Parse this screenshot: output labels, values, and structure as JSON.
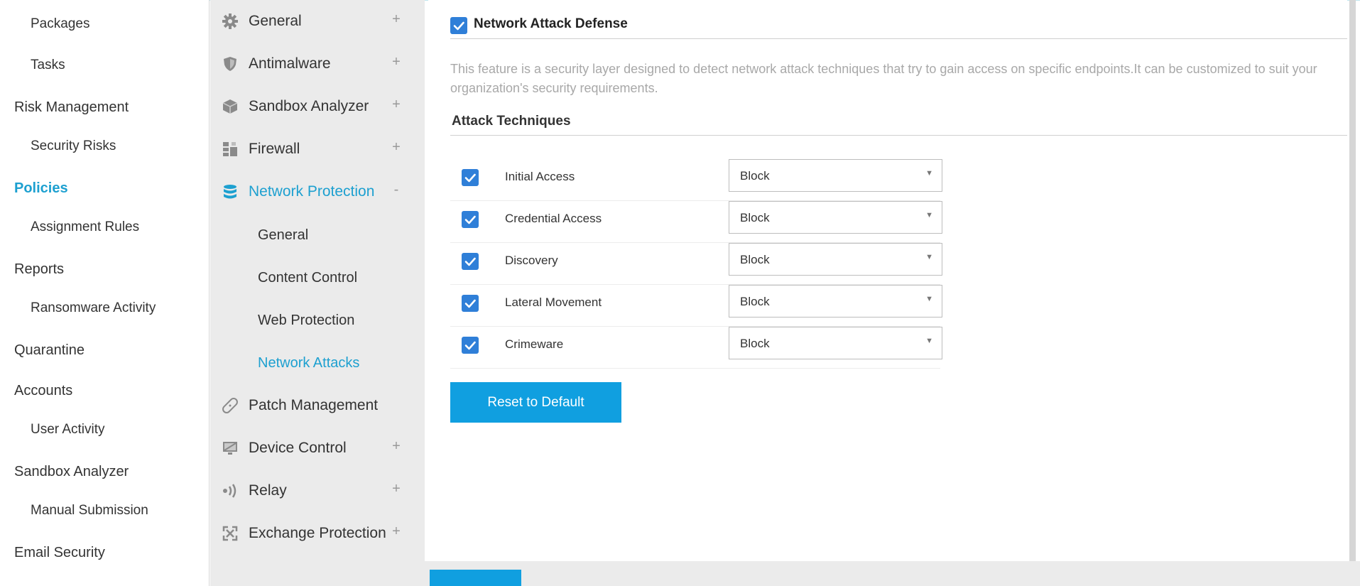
{
  "nav": {
    "items": [
      {
        "label": "Packages"
      },
      {
        "label": "Tasks"
      },
      {
        "label": "Risk Management"
      },
      {
        "label": "Security Risks"
      },
      {
        "label": "Policies"
      },
      {
        "label": "Assignment Rules"
      },
      {
        "label": "Reports"
      },
      {
        "label": "Ransomware Activity"
      },
      {
        "label": "Quarantine"
      },
      {
        "label": "Accounts"
      },
      {
        "label": "User Activity"
      },
      {
        "label": "Sandbox Analyzer"
      },
      {
        "label": "Manual Submission"
      },
      {
        "label": "Email Security"
      }
    ]
  },
  "sections": {
    "items": [
      {
        "label": "General",
        "icon": "gear-icon",
        "toggle": "+"
      },
      {
        "label": "Antimalware",
        "icon": "shield-icon",
        "toggle": "+"
      },
      {
        "label": "Sandbox Analyzer",
        "icon": "cube-icon",
        "toggle": "+"
      },
      {
        "label": "Firewall",
        "icon": "firewall-icon",
        "toggle": "+"
      },
      {
        "label": "Network Protection",
        "icon": "database-icon",
        "toggle": "-"
      },
      {
        "label": "Patch Management",
        "icon": "bandage-icon",
        "toggle": ""
      },
      {
        "label": "Device Control",
        "icon": "monitor-icon",
        "toggle": "+"
      },
      {
        "label": "Relay",
        "icon": "broadcast-icon",
        "toggle": "+"
      },
      {
        "label": "Exchange Protection",
        "icon": "exchange-icon",
        "toggle": "+"
      }
    ],
    "network_protection_subs": [
      {
        "label": "General"
      },
      {
        "label": "Content Control"
      },
      {
        "label": "Web Protection"
      },
      {
        "label": "Network Attacks"
      }
    ]
  },
  "content": {
    "title": "Network Attack Defense",
    "title_checked": true,
    "description": "This feature is a security layer designed to detect network attack techniques that try to gain access on specific endpoints.It can be customized to suit your organization's security requirements.",
    "techniques_title": "Attack Techniques",
    "techniques": [
      {
        "name": "Initial Access",
        "checked": true,
        "action": "Block"
      },
      {
        "name": "Credential Access",
        "checked": true,
        "action": "Block"
      },
      {
        "name": "Discovery",
        "checked": true,
        "action": "Block"
      },
      {
        "name": "Lateral Movement",
        "checked": true,
        "action": "Block"
      },
      {
        "name": "Crimeware",
        "checked": true,
        "action": "Block"
      }
    ],
    "reset_label": "Reset to Default"
  },
  "colors": {
    "accent": "#1da0d0",
    "button": "#109fe0",
    "checkbox": "#2f7fd8",
    "panel_bg": "#ebebeb"
  }
}
